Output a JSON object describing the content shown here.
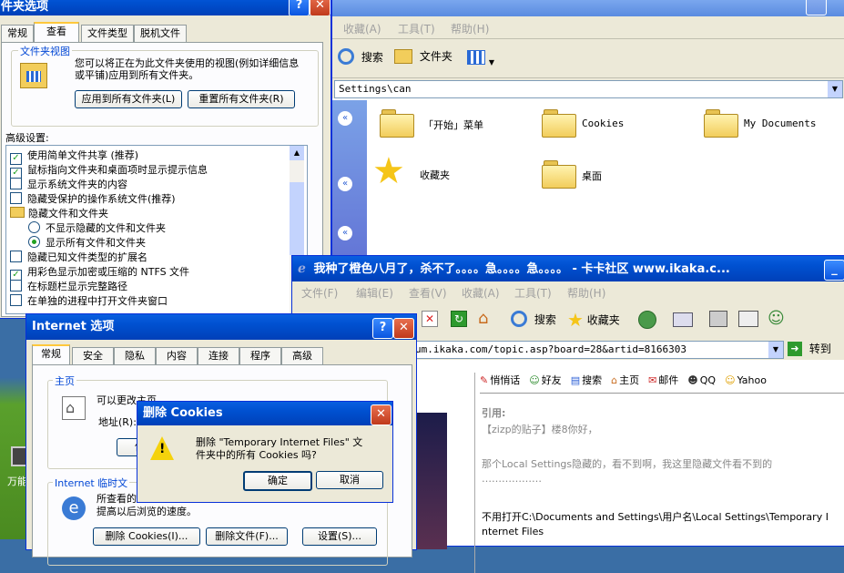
{
  "explorer": {
    "menu": [
      "收藏(A)",
      "工具(T)",
      "帮助(H)"
    ],
    "toolbar": {
      "search": "搜索",
      "folders": "文件夹"
    },
    "address": "Settings\\can",
    "items": [
      "「开始」菜单",
      "Cookies",
      "My Documents",
      "收藏夹",
      "桌面"
    ]
  },
  "folder_options": {
    "title": "件夹选项",
    "tabs": [
      "常规",
      "查看",
      "文件类型",
      "脱机文件"
    ],
    "group_title": "文件夹视图",
    "description": "您可以将正在为此文件夹使用的视图(例如详细信息或平铺)应用到所有文件夹。",
    "apply_all": "应用到所有文件夹(L)",
    "reset_all": "重置所有文件夹(R)",
    "advanced_label": "高级设置:",
    "settings": [
      {
        "text": "使用简单文件共享 (推荐)",
        "type": "check",
        "checked": true
      },
      {
        "text": "鼠标指向文件夹和桌面项时显示提示信息",
        "type": "check",
        "checked": true
      },
      {
        "text": "显示系统文件夹的内容",
        "type": "check",
        "checked": false
      },
      {
        "text": "隐藏受保护的操作系统文件(推荐)",
        "type": "check",
        "checked": false
      },
      {
        "text": "隐藏文件和文件夹",
        "type": "folder",
        "checked": false
      },
      {
        "text": "不显示隐藏的文件和文件夹",
        "type": "radio",
        "checked": false
      },
      {
        "text": "显示所有文件和文件夹",
        "type": "radio",
        "checked": true
      },
      {
        "text": "隐藏已知文件类型的扩展名",
        "type": "check",
        "checked": false
      },
      {
        "text": "用彩色显示加密或压缩的 NTFS 文件",
        "type": "check",
        "checked": true
      },
      {
        "text": "在标题栏显示完整路径",
        "type": "check",
        "checked": false
      },
      {
        "text": "在单独的进程中打开文件夹窗口",
        "type": "check",
        "checked": false
      }
    ]
  },
  "browser": {
    "title": "我种了橙色八月了，杀不了。。。。急。。。。急。。。。 - 卡卡社区 www.ikaka.c...",
    "menu": [
      "文件(F)",
      "编辑(E)",
      "查看(V)",
      "收藏(A)",
      "工具(T)",
      "帮助(H)"
    ],
    "toolbar": {
      "search": "搜索",
      "favorites": "收藏夹"
    },
    "address": "um.ikaka.com/topic.asp?board=28&artid=8166303",
    "go": "转到",
    "links": [
      "悄悄话",
      "好友",
      "搜索",
      "主页",
      "邮件",
      "QQ",
      "Yahoo"
    ],
    "post": {
      "quote_label": "引用:",
      "quote_line": "【zizp的贴子】楼8你好，",
      "quote_body": "那个Local Settings隐藏的，看不到啊，我这里隐藏文件看不到的",
      "dots": "………………",
      "reply_line1": "不用打开C:\\Documents and Settings\\用户名\\Local Settings\\Temporary I",
      "reply_line2": "nternet Files"
    }
  },
  "internet_options": {
    "title": "Internet 选项",
    "tabs": [
      "常规",
      "安全",
      "隐私",
      "内容",
      "连接",
      "程序",
      "高级"
    ],
    "home_group": "主页",
    "home_desc": "可以更改主页。",
    "address_label": "地址(R):",
    "use_current": "使用",
    "temp_group": "Internet 临时文",
    "temp_desc1": "所查看的",
    "temp_desc2": "提高以后浏览的速度。",
    "delete_cookies": "删除 Cookies(I)...",
    "delete_files": "删除文件(F)...",
    "settings": "设置(S)..."
  },
  "cookies_dialog": {
    "title": "删除 Cookies",
    "message_line1": "删除 \"Temporary Internet Files\" 文",
    "message_line2": "件夹中的所有 Cookies 吗?",
    "ok": "确定",
    "cancel": "取消"
  },
  "desktop": {
    "icon_label": "万能"
  }
}
